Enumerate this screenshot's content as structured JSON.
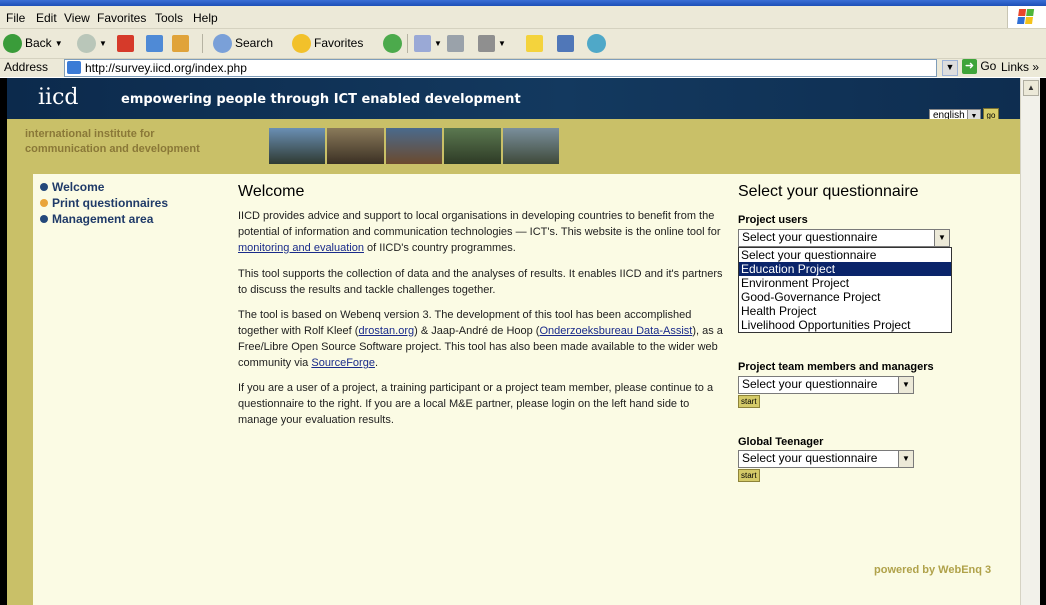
{
  "browser": {
    "menu": [
      "File",
      "Edit",
      "View",
      "Favorites",
      "Tools",
      "Help"
    ],
    "toolbar": {
      "back_label": "Back",
      "search_label": "Search",
      "favorites_label": "Favorites"
    },
    "address_label": "Address",
    "url": "http://survey.iicd.org/index.php",
    "go_label": "Go",
    "links_label": "Links »"
  },
  "header": {
    "logo": "iicd",
    "tagline": "empowering people through ICT enabled development",
    "language": "english",
    "go_small": "go",
    "institute_line1": "international institute for",
    "institute_line2": "communication and development"
  },
  "nav": [
    {
      "label": "Welcome"
    },
    {
      "label": "Print questionnaires"
    },
    {
      "label": "Management area"
    }
  ],
  "main": {
    "title": "Welcome",
    "p1_pre": "IICD provides advice and support to local organisations in developing countries to benefit from the potential of information and communication technologies — ICT's. This website is the online tool for ",
    "p1_link": "monitoring and evaluation",
    "p1_post": " of IICD's country programmes.",
    "p2": "This tool supports the collection of data and the analyses of results. It enables IICD and it's partners to discuss the results and tackle challenges together.",
    "p3_a": "The tool is based on Webenq version 3. The development of this tool has been accomplished together with Rolf Kleef (",
    "p3_link1": "drostan.org",
    "p3_b": ") & Jaap-André de Hoop (",
    "p3_link2": "Onderzoeksbureau Data-Assist",
    "p3_c": "), as a Free/Libre Open Source Software project. This tool has also been made available to the wider web community via ",
    "p3_link3": "SourceForge",
    "p3_d": ".",
    "p4": "If you are a user of a project, a training participant or a project team member, please continue to a questionnaire to the right. If you are a local M&E partner, please login on the left hand side to manage your evaluation results."
  },
  "questionnaire": {
    "title": "Select your questionnaire",
    "project_users_label": "Project users",
    "project_users_value": "Select your questionnaire",
    "options": [
      "Select your questionnaire",
      "Education Project",
      "Environment Project",
      "Good-Governance Project",
      "Health Project",
      "Livelihood Opportunities Project"
    ],
    "selected_index": 1,
    "team_label": "Project team members and managers",
    "team_value": "Select your questionnaire",
    "teen_label": "Global Teenager",
    "teen_value": "Select your questionnaire",
    "start_label": "start"
  },
  "footer": {
    "powered": "powered by WebEnq 3"
  }
}
